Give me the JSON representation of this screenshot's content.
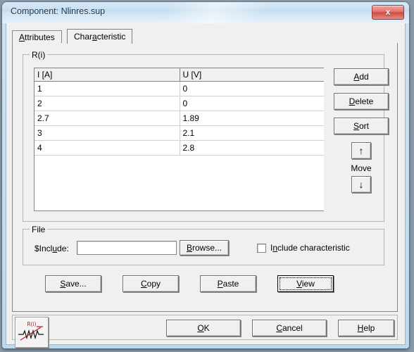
{
  "window": {
    "title": "Component: Nlinres.sup",
    "close_label": "x",
    "close_icon": "close-icon"
  },
  "tabs": [
    {
      "label": "Attributes",
      "accel_index": 0,
      "active": false
    },
    {
      "label": "Characteristic",
      "accel_index": 4,
      "active": true
    }
  ],
  "characteristic": {
    "group_title": "R(i)",
    "table": {
      "columns": [
        "I [A]",
        "U [V]"
      ],
      "rows": [
        [
          "1",
          "0"
        ],
        [
          "2",
          "0"
        ],
        [
          "2.7",
          "1.89"
        ],
        [
          "3",
          "2.1"
        ],
        [
          "4",
          "2.8"
        ]
      ]
    },
    "side_buttons": {
      "add": "Add",
      "delete": "Delete",
      "sort": "Sort",
      "move_up_icon": "arrow-up-icon",
      "move_up_glyph": "↑",
      "move_label": "Move",
      "move_down_icon": "arrow-down-icon",
      "move_down_glyph": "↓"
    },
    "file": {
      "group_title": "File",
      "include_label": "$Include:",
      "include_value": "",
      "include_placeholder": "",
      "browse": "Browse...",
      "checkbox_label": "Include characteristic",
      "checkbox_checked": false
    },
    "actions": {
      "save": "Save...",
      "copy": "Copy",
      "paste": "Paste",
      "view": "View",
      "focused": "View"
    }
  },
  "bottom": {
    "icon_name": "nonlinear-resistor-icon",
    "icon_label": "R(i)",
    "icon_label_color": "#b02020",
    "ok": "OK",
    "cancel": "Cancel",
    "help": "Help"
  },
  "colors": {
    "titlebar_from": "#d7e9f7",
    "titlebar_to": "#e6f1fb",
    "frame": "#bcd8ec",
    "face": "#f0f0f0",
    "close_red": "#d14a42",
    "text": "#000000"
  }
}
